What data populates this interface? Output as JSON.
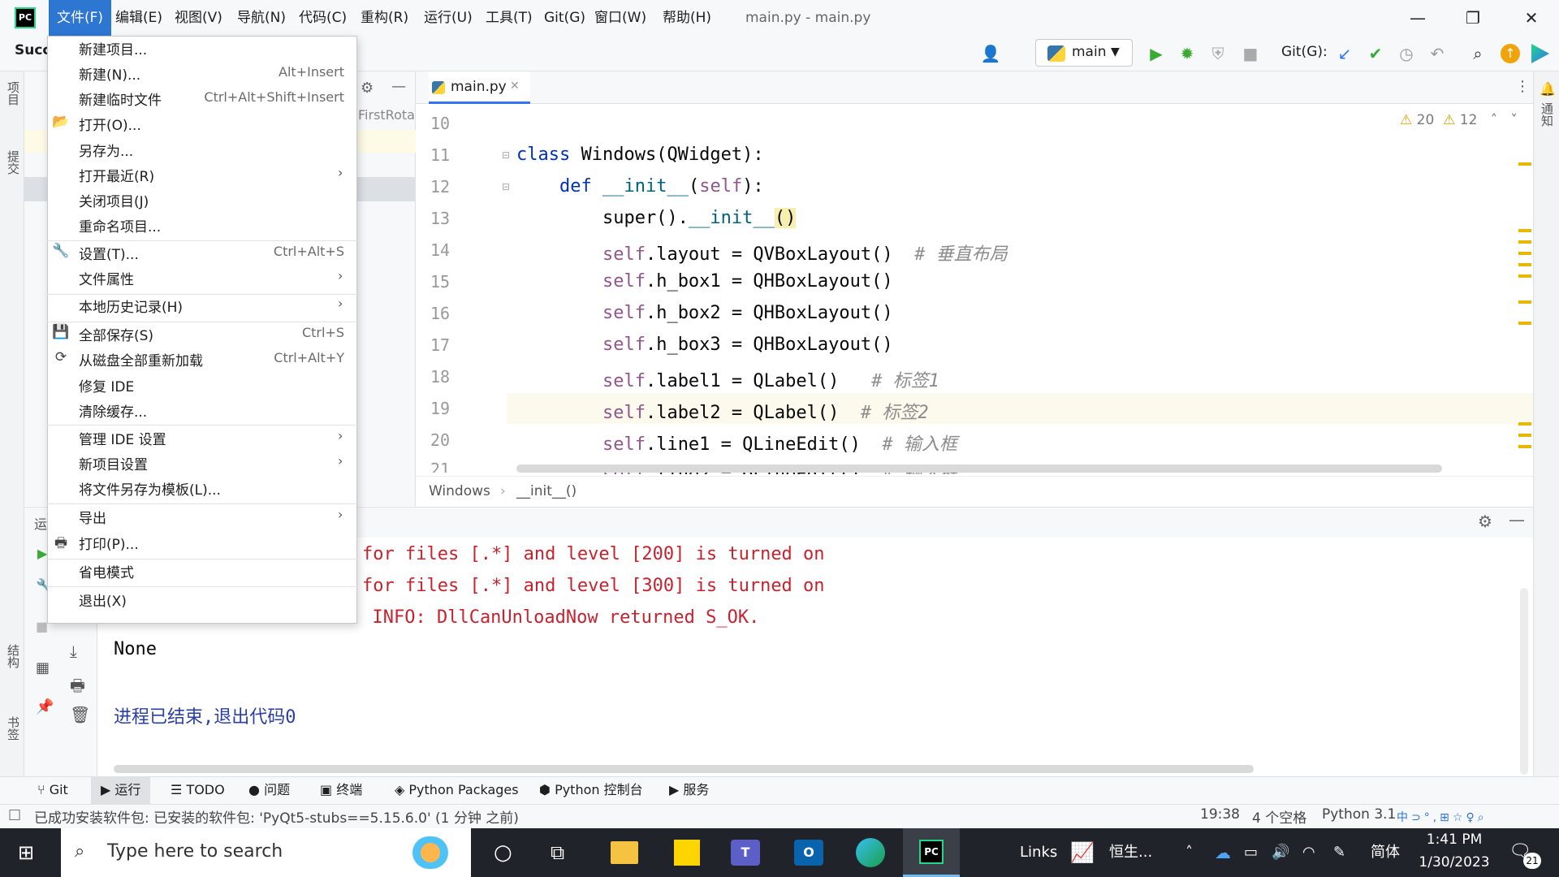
{
  "app": {
    "logo_text": "PC",
    "window_title": "main.py - main.py"
  },
  "menubar": {
    "items": [
      "文件(F)",
      "编辑(E)",
      "视图(V)",
      "导航(N)",
      "代码(C)",
      "重构(R)",
      "运行(U)",
      "工具(T)",
      "Git(G)",
      "窗口(W)",
      "帮助(H)"
    ]
  },
  "toolbar": {
    "left_label": "Succ",
    "run_config": "main",
    "git_label": "Git(G):"
  },
  "left_strip": {
    "project": "项目",
    "commit": "提交",
    "structure": "结构",
    "bookmarks": "书签"
  },
  "right_strip": {
    "notifications": "通知"
  },
  "project_panel": {
    "partial_text": "FirstRota"
  },
  "editor": {
    "tab": "main.py",
    "warnings": "20",
    "weak_warnings": "12",
    "line_numbers": [
      "10",
      "11",
      "12",
      "13",
      "14",
      "15",
      "16",
      "17",
      "18",
      "19",
      "20",
      "21"
    ],
    "breadcrumb": [
      "Windows",
      "__init__()"
    ]
  },
  "run_panel": {
    "label": "运",
    "output": [
      "for files [.*] and level [200] is turned on",
      "for files [.*] and level [300] is turned on",
      ": INFO: DllCanUnloadNow returned S_OK.",
      "None",
      "进程已结束,退出代码0"
    ]
  },
  "tool_tabs": [
    "Git",
    "运行",
    "TODO",
    "问题",
    "终端",
    "Python Packages",
    "Python 控制台",
    "服务"
  ],
  "status": {
    "message": "已成功安装软件包: 已安装的软件包: 'PyQt5-stubs==5.15.6.0' (1 分钟 之前)",
    "position": "19:38",
    "indent": "4 个空格",
    "interpreter": "Python 3.10"
  },
  "taskbar": {
    "search_placeholder": "Type here to search",
    "links": "Links",
    "stock": "恒生...",
    "ime": "简体",
    "time": "1:41 PM",
    "date": "1/30/2023",
    "notif_count": "21"
  },
  "file_menu": {
    "items": [
      {
        "label": "新建项目...",
        "shortcut": "",
        "submenu": false
      },
      {
        "label": "新建(N)...",
        "shortcut": "Alt+Insert",
        "submenu": false
      },
      {
        "label": "新建临时文件",
        "shortcut": "Ctrl+Alt+Shift+Insert",
        "submenu": false
      },
      {
        "label": "打开(O)...",
        "shortcut": "",
        "submenu": false,
        "icon": "folder-icon"
      },
      {
        "label": "另存为...",
        "shortcut": "",
        "submenu": false
      },
      {
        "label": "打开最近(R)",
        "shortcut": "",
        "submenu": true
      },
      {
        "label": "关闭项目(J)",
        "shortcut": "",
        "submenu": false
      },
      {
        "label": "重命名项目...",
        "shortcut": "",
        "submenu": false
      },
      {
        "label": "设置(T)...",
        "shortcut": "Ctrl+Alt+S",
        "submenu": false,
        "icon": "wrench-icon"
      },
      {
        "label": "文件属性",
        "shortcut": "",
        "submenu": true
      },
      {
        "label": "本地历史记录(H)",
        "shortcut": "",
        "submenu": true
      },
      {
        "label": "全部保存(S)",
        "shortcut": "Ctrl+S",
        "submenu": false,
        "icon": "save-icon"
      },
      {
        "label": "从磁盘全部重新加载",
        "shortcut": "Ctrl+Alt+Y",
        "submenu": false,
        "icon": "reload-icon"
      },
      {
        "label": "修复 IDE",
        "shortcut": "",
        "submenu": false
      },
      {
        "label": "清除缓存...",
        "shortcut": "",
        "submenu": false
      },
      {
        "label": "管理 IDE 设置",
        "shortcut": "",
        "submenu": true
      },
      {
        "label": "新项目设置",
        "shortcut": "",
        "submenu": true
      },
      {
        "label": "将文件另存为模板(L)...",
        "shortcut": "",
        "submenu": false
      },
      {
        "label": "导出",
        "shortcut": "",
        "submenu": true
      },
      {
        "label": "打印(P)...",
        "shortcut": "",
        "submenu": false,
        "icon": "print-icon"
      },
      {
        "label": "省电模式",
        "shortcut": "",
        "submenu": false
      },
      {
        "label": "退出(X)",
        "shortcut": "",
        "submenu": false
      }
    ]
  }
}
